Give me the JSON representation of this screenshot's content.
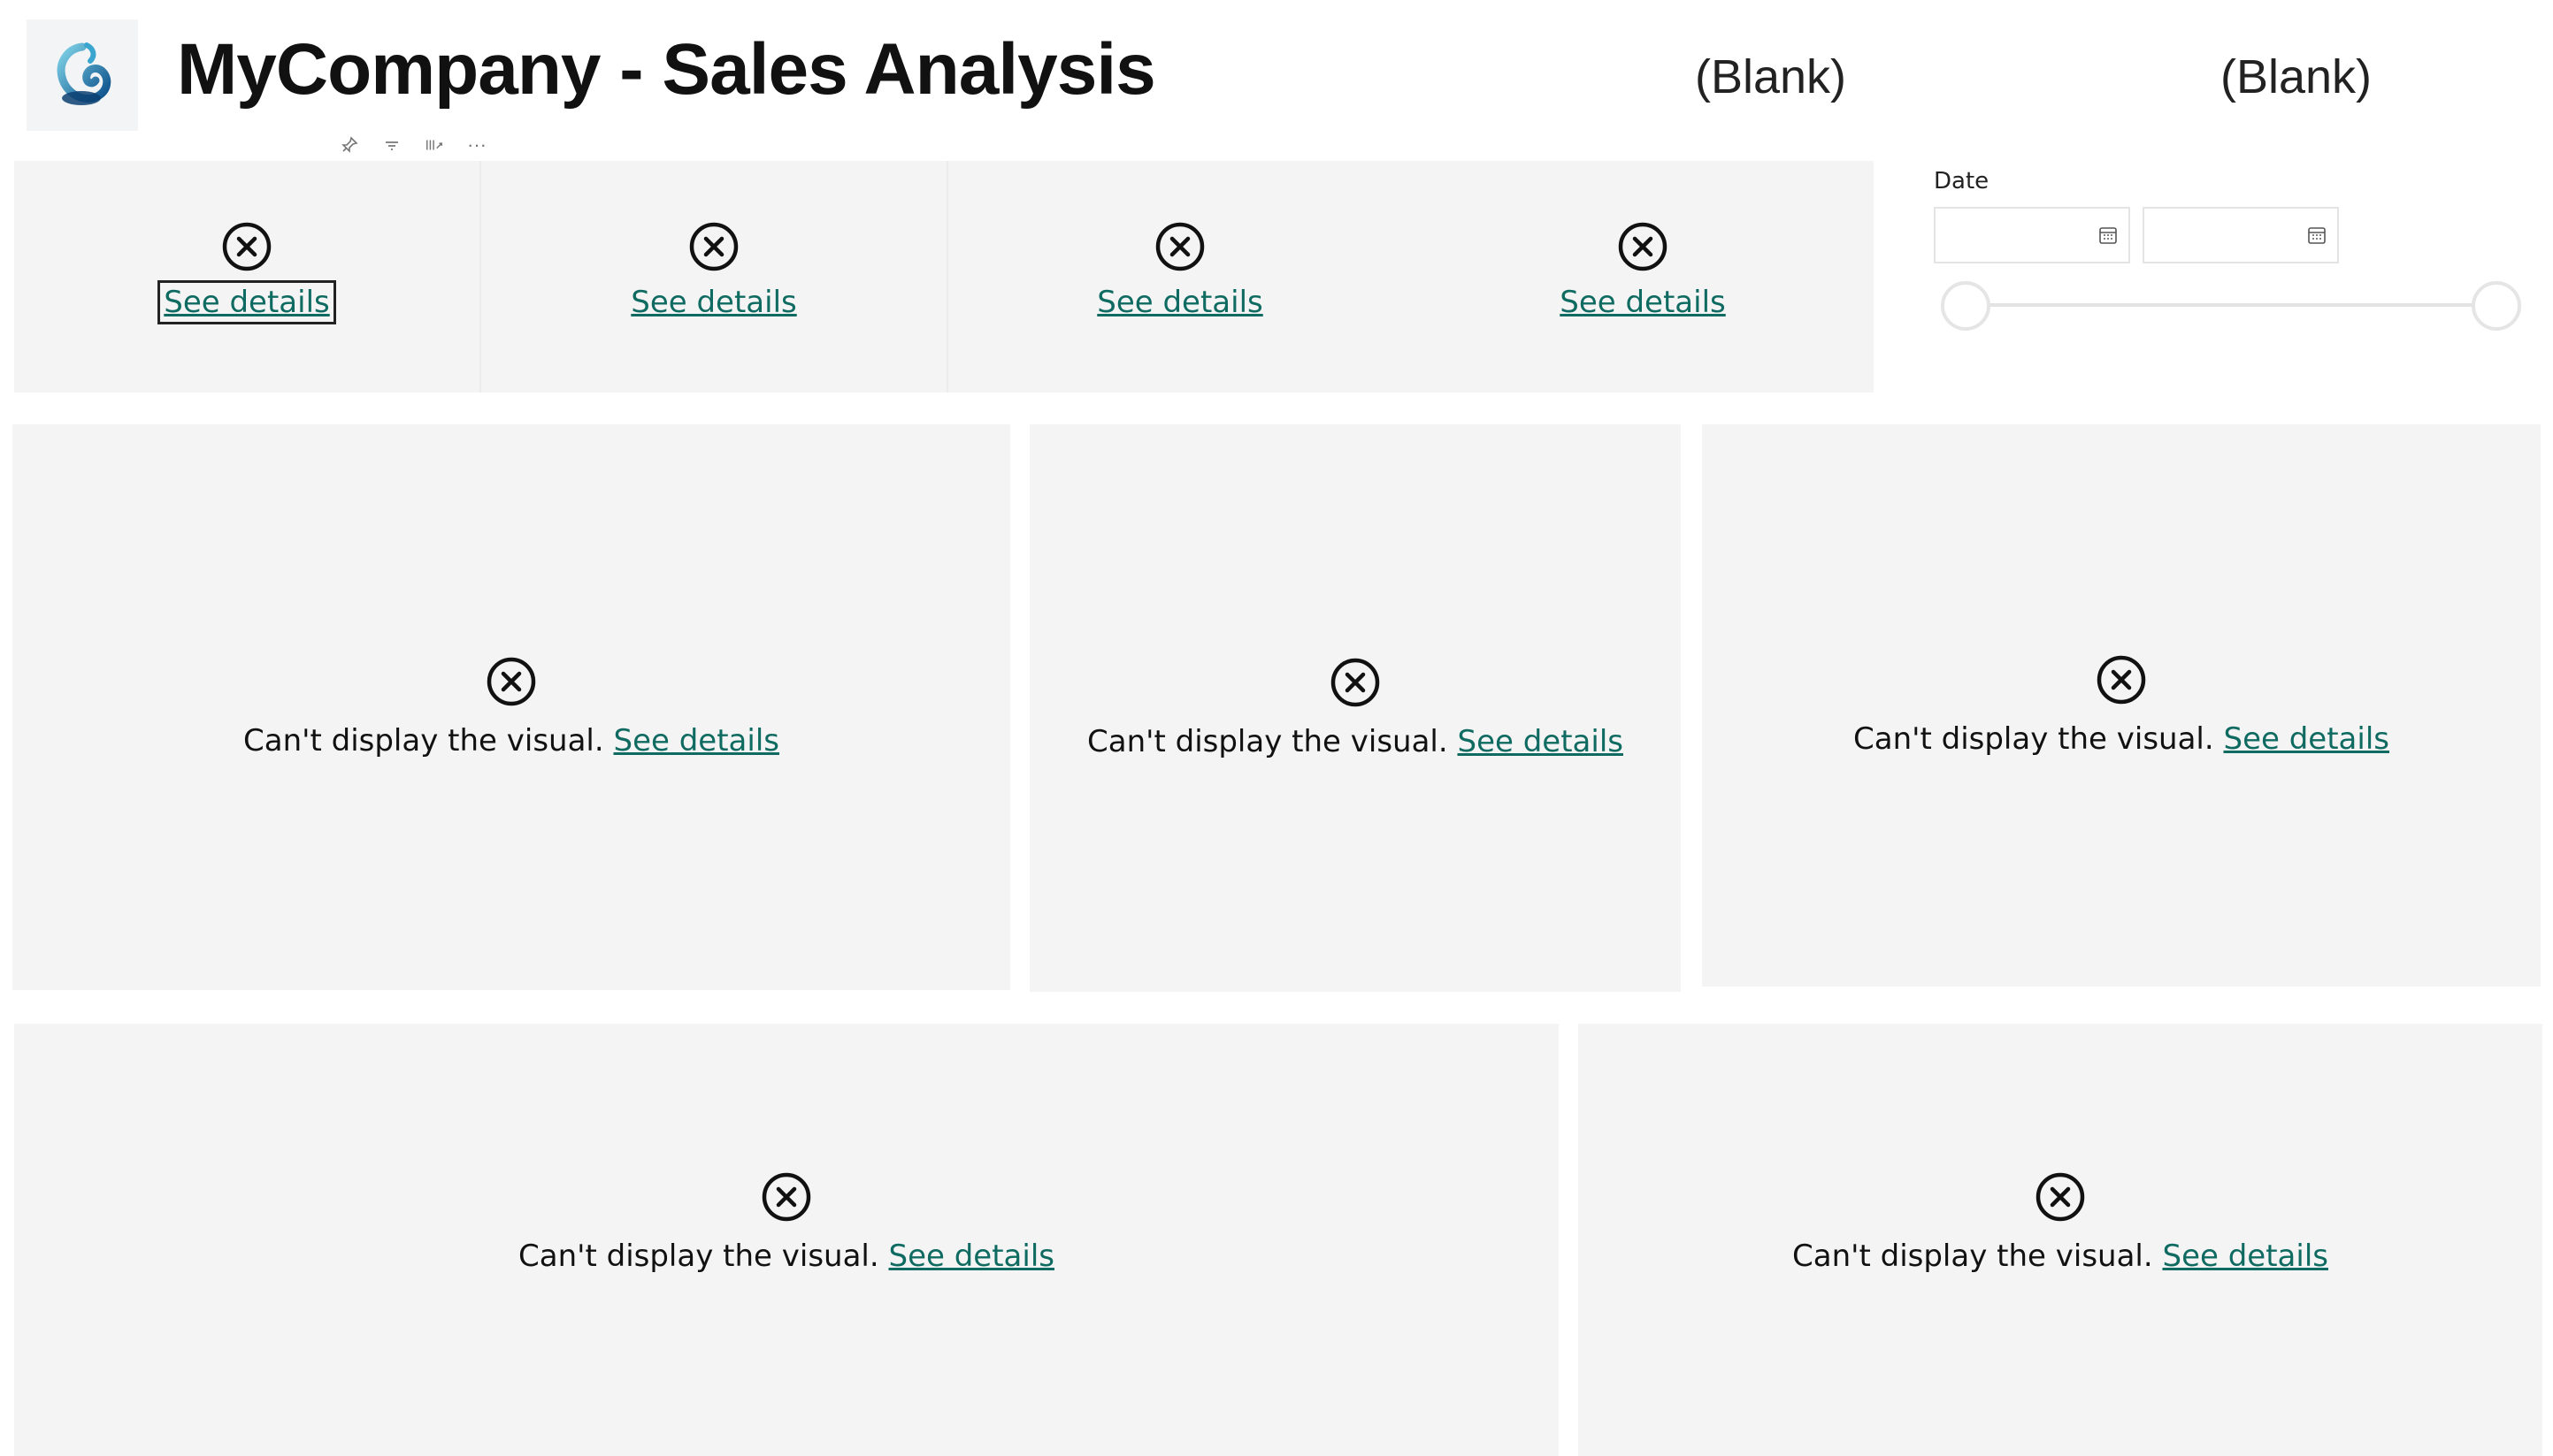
{
  "header": {
    "title_plain": "MyCompany - ",
    "title_bold": "Sales Analysis",
    "blank_1": "(Blank)",
    "blank_2": "(Blank)"
  },
  "toolbar": {
    "icons": [
      "pin-icon",
      "filter-icon",
      "focus-mode-icon",
      "more-options-icon"
    ],
    "more_label": "···"
  },
  "cards": [
    {
      "link": "See details"
    },
    {
      "link": "See details"
    },
    {
      "link": "See details"
    },
    {
      "link": "See details"
    }
  ],
  "slicer": {
    "label": "Date",
    "start_value": "",
    "end_value": ""
  },
  "visuals": [
    {
      "message": "Can't display the visual.",
      "link": "See details"
    },
    {
      "message": "Can't display the visual.",
      "link": "See details"
    },
    {
      "message": "Can't display the visual.",
      "link": "See details"
    },
    {
      "message": "Can't display the visual.",
      "link": "See details"
    },
    {
      "message": "Can't display the visual.",
      "link": "See details"
    }
  ],
  "colors": {
    "link": "#0f6b61",
    "panel_bg": "#f4f4f4",
    "error_icon": "#111111"
  }
}
